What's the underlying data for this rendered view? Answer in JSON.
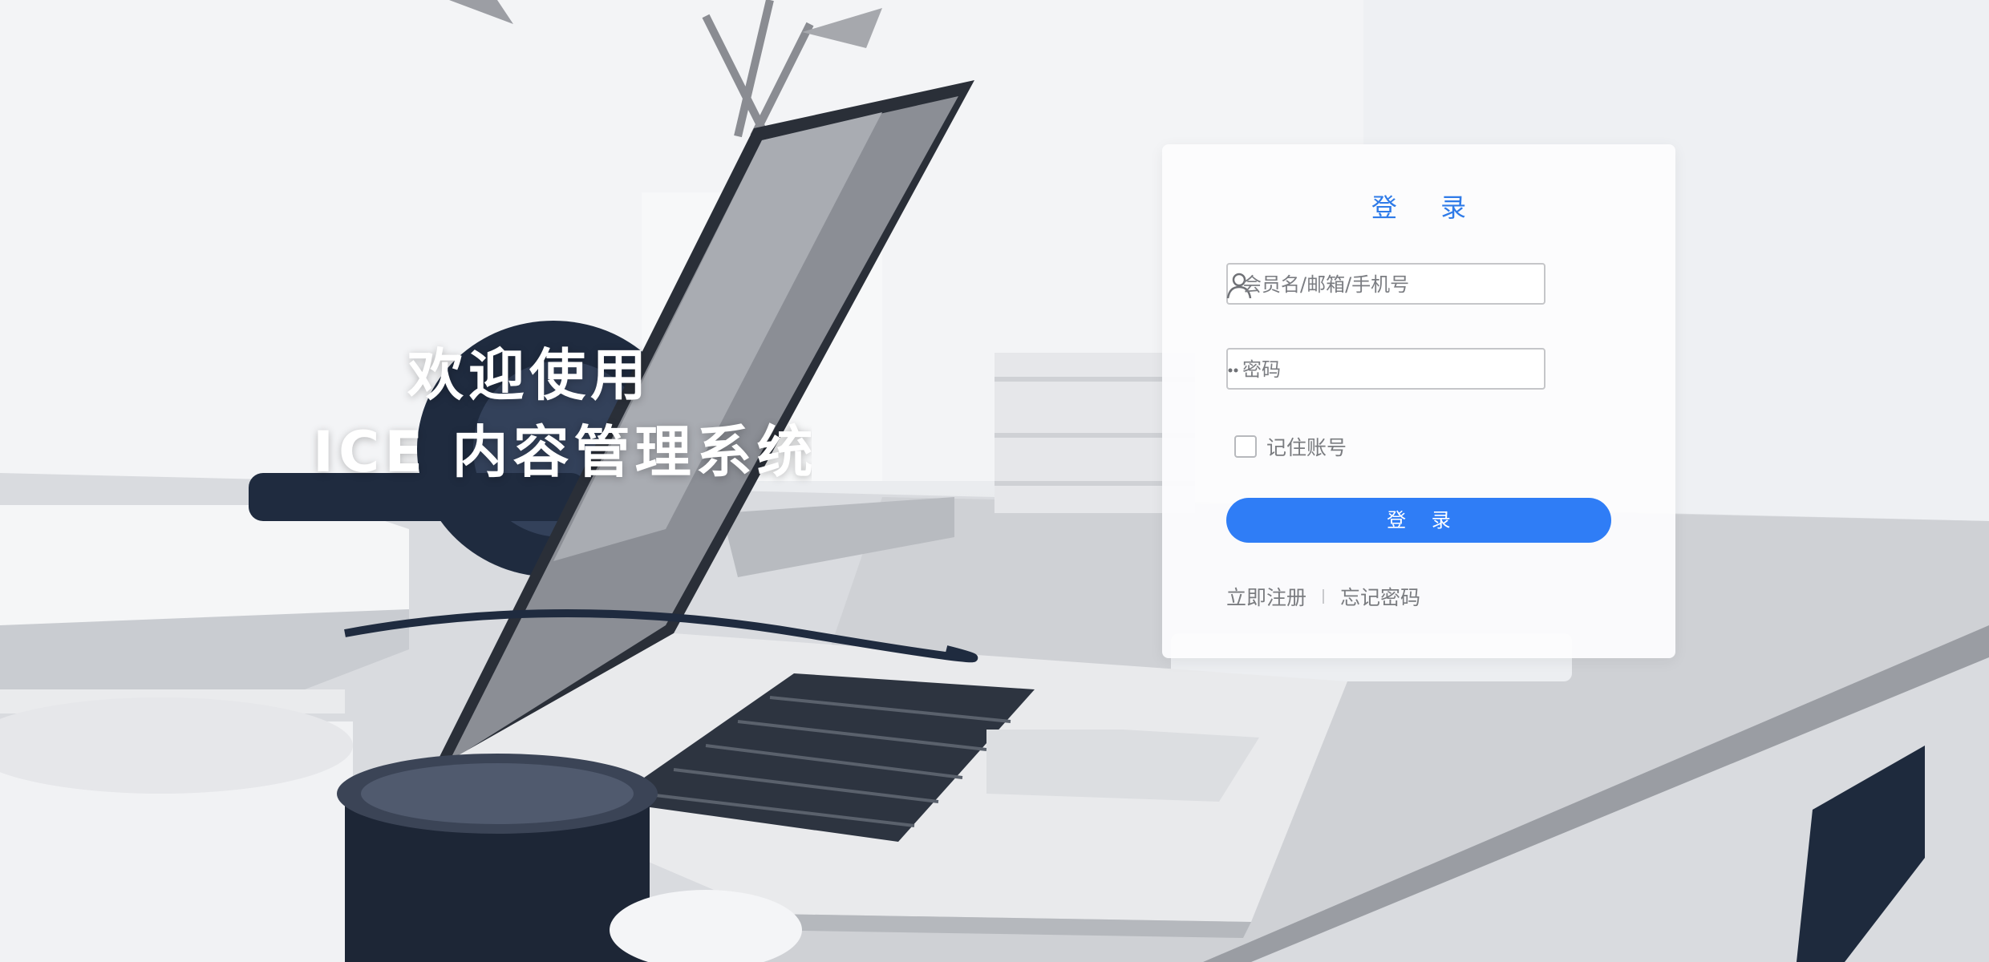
{
  "welcome": {
    "line1": "欢迎使用",
    "line2": "ICE 内容管理系统"
  },
  "login_card": {
    "title": "登 录",
    "username": {
      "placeholder": "会员名/邮箱/手机号",
      "icon": "user-icon"
    },
    "password": {
      "placeholder": "密码",
      "icon": "password-dots-icon"
    },
    "remember_label": "记住账号",
    "remember_checked": false,
    "submit_label": "登 录",
    "register_link": "立即注册",
    "forgot_link": "忘记密码"
  },
  "colors": {
    "accent": "#2f7df6",
    "title": "#2f7be8",
    "muted_text": "#7a7c80",
    "border": "#c5c6c9"
  }
}
